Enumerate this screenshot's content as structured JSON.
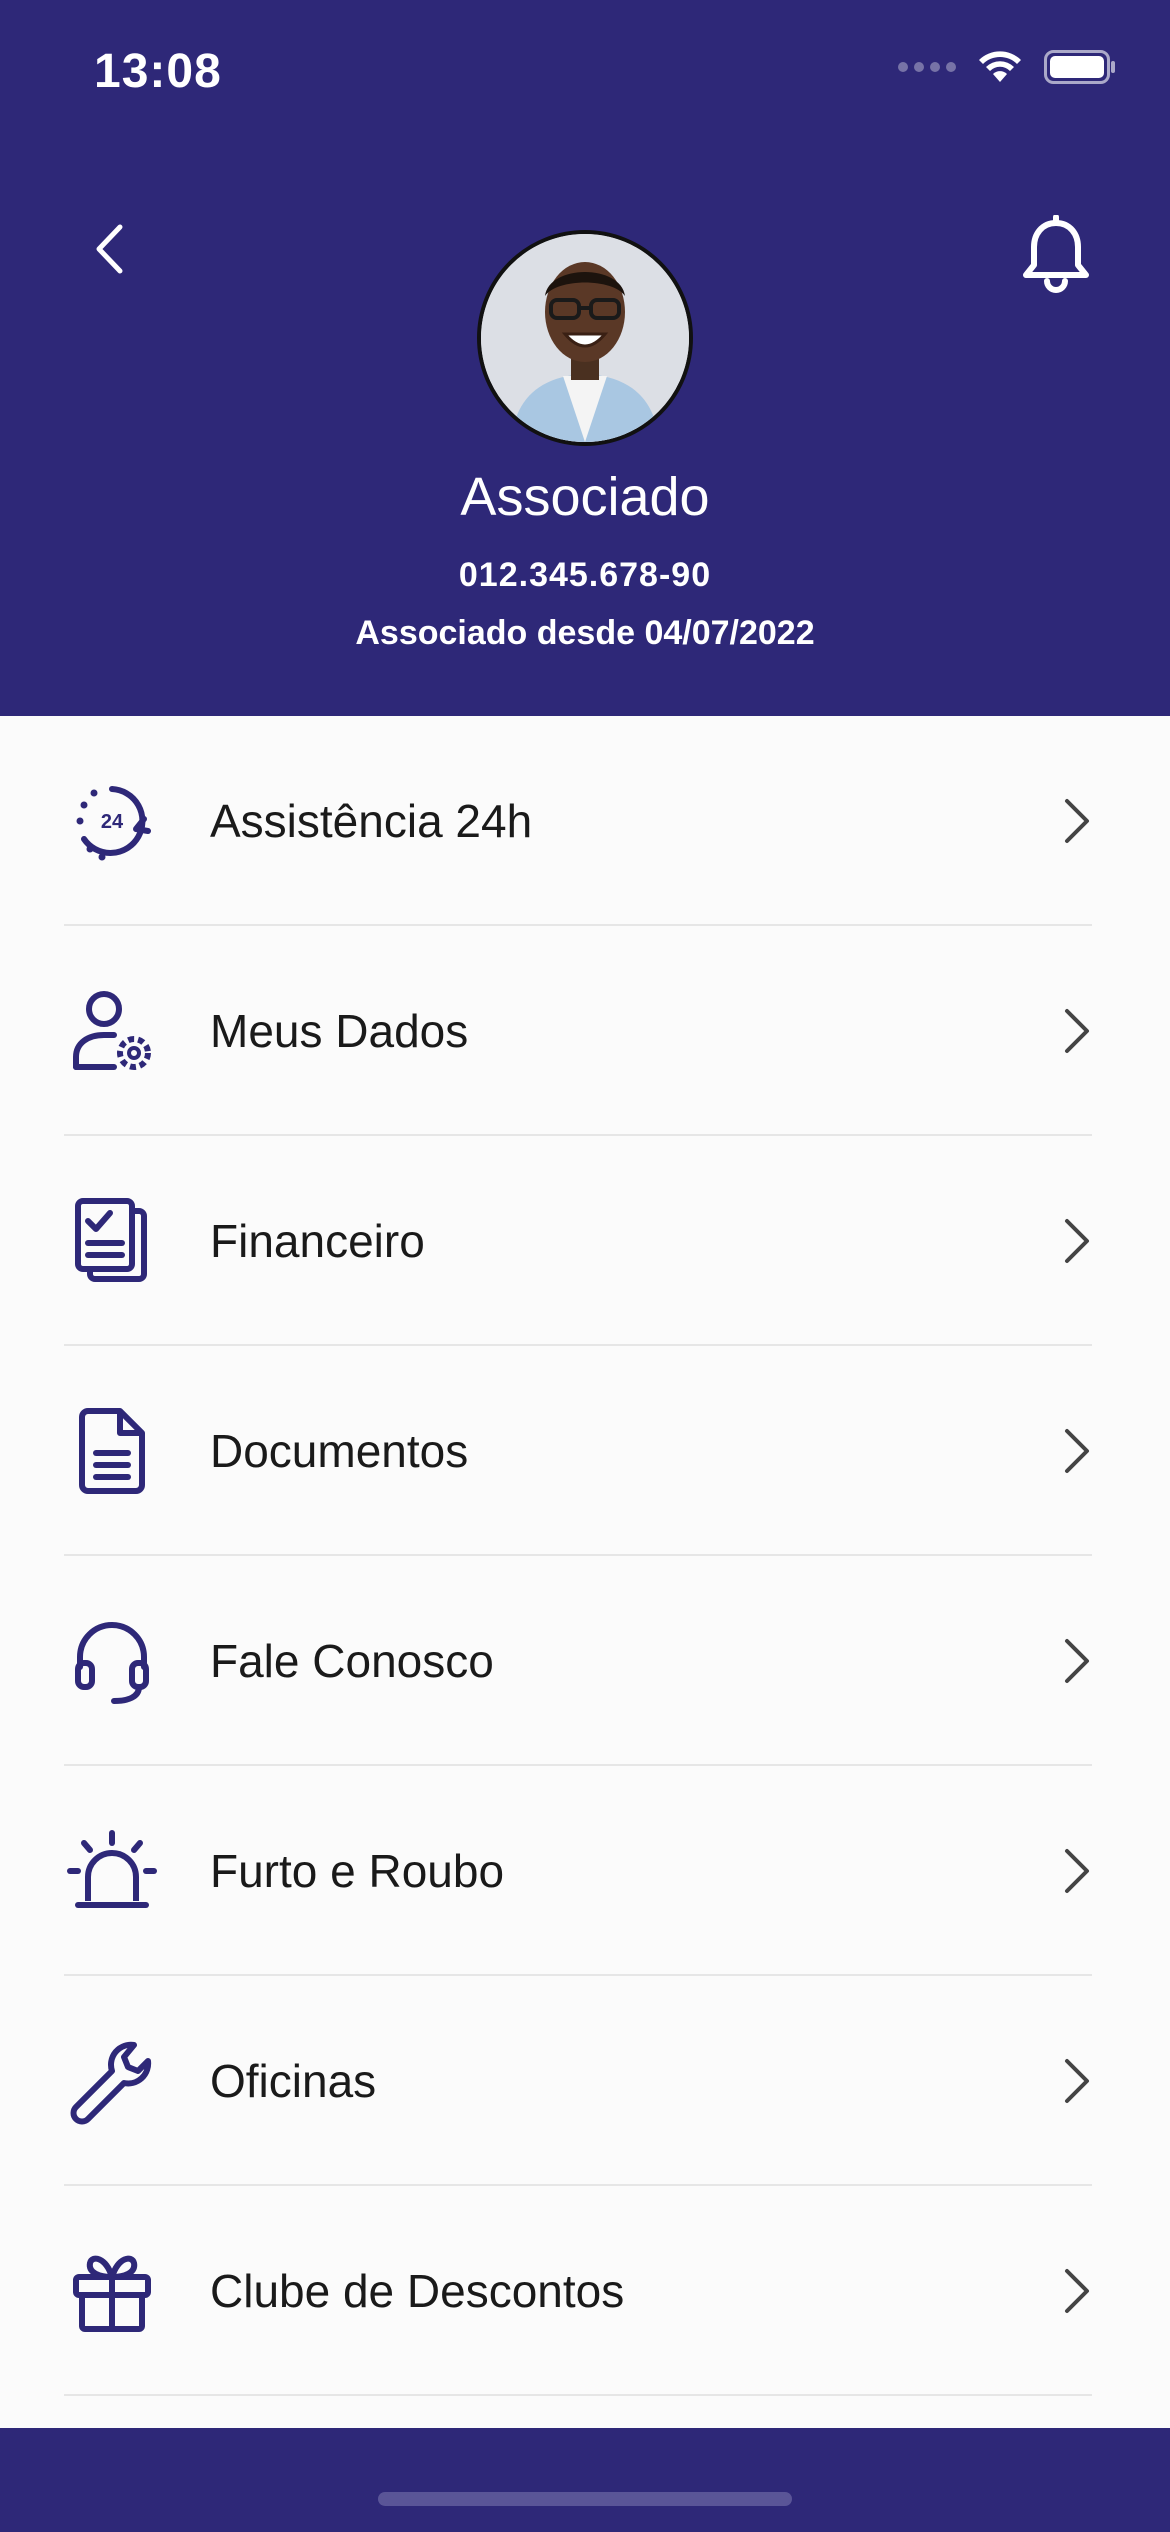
{
  "status_bar": {
    "time": "13:08"
  },
  "profile": {
    "name": "Associado",
    "cpf": "012.345.678-90",
    "member_since": "Associado desde 04/07/2022"
  },
  "menu": [
    {
      "label": "Assistência 24h",
      "icon": "assistance-24h-icon"
    },
    {
      "label": "Meus Dados",
      "icon": "user-settings-icon"
    },
    {
      "label": "Financeiro",
      "icon": "financial-documents-icon"
    },
    {
      "label": "Documentos",
      "icon": "document-icon"
    },
    {
      "label": "Fale Conosco",
      "icon": "headset-icon"
    },
    {
      "label": "Furto e Roubo",
      "icon": "alarm-siren-icon"
    },
    {
      "label": "Oficinas",
      "icon": "wrench-icon"
    },
    {
      "label": "Clube de Descontos",
      "icon": "gift-icon"
    }
  ],
  "colors": {
    "brand": "#2e2878",
    "background": "#fbfbfb",
    "text": "#1a1a1a"
  }
}
